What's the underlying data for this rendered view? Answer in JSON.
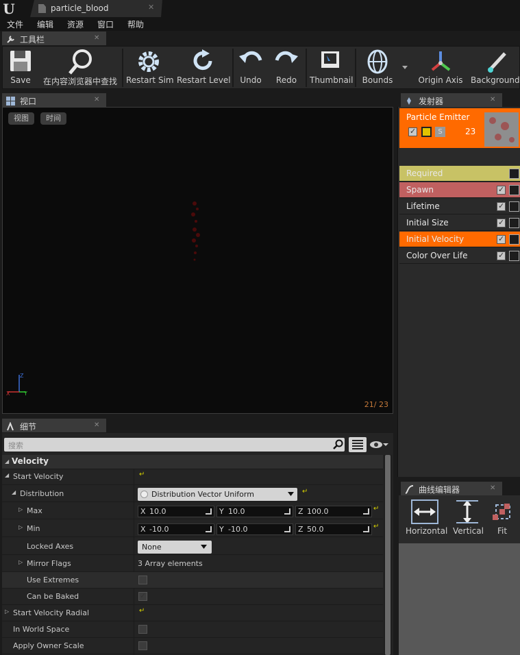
{
  "document_tab": {
    "title": "particle_blood"
  },
  "menu": [
    "文件",
    "编辑",
    "资源",
    "窗口",
    "帮助"
  ],
  "toolbar_panel": {
    "title": "工具栏"
  },
  "toolbar": [
    {
      "label": "Save",
      "icon": "save-icon"
    },
    {
      "label": "在内容浏览器中查找",
      "icon": "find-in-browser-icon"
    },
    {
      "label": "Restart Sim",
      "icon": "restart-sim-icon"
    },
    {
      "label": "Restart Level",
      "icon": "restart-level-icon"
    },
    {
      "label": "Undo",
      "icon": "undo-icon"
    },
    {
      "label": "Redo",
      "icon": "redo-icon"
    },
    {
      "label": "Thumbnail",
      "icon": "thumbnail-icon"
    },
    {
      "label": "Bounds",
      "icon": "bounds-icon"
    },
    {
      "label": "Origin Axis",
      "icon": "origin-axis-icon"
    },
    {
      "label": "Background C",
      "icon": "background-color-icon"
    }
  ],
  "viewport_panel": {
    "title": "视口",
    "view_button": "视图",
    "time_button": "时间",
    "frame_counter": "21/ 23"
  },
  "emitters_panel": {
    "title": "发射器",
    "emitter": {
      "name": "Particle Emitter",
      "count": "23",
      "solo_label": "S"
    },
    "modules": [
      {
        "name": "Required",
        "color": "#c8c265"
      },
      {
        "name": "Spawn",
        "color": "#c06060"
      },
      {
        "name": "Lifetime",
        "color": "#2a2a2a"
      },
      {
        "name": "Initial Size",
        "color": "#2a2a2a"
      },
      {
        "name": "Initial Velocity",
        "color": "#ff6a00"
      },
      {
        "name": "Color Over Life",
        "color": "#2a2a2a"
      }
    ]
  },
  "details_panel": {
    "title": "细节",
    "search_placeholder": "搜索",
    "category": "Velocity",
    "start_velocity": "Start Velocity",
    "distribution_label": "Distribution",
    "distribution_value": "Distribution Vector Uniform",
    "max": {
      "label": "Max",
      "x": "10.0",
      "y": "10.0",
      "z": "100.0"
    },
    "min": {
      "label": "Min",
      "x": "-10.0",
      "y": "-10.0",
      "z": "50.0"
    },
    "locked_axes": {
      "label": "Locked Axes",
      "value": "None"
    },
    "mirror_flags": {
      "label": "Mirror Flags",
      "value": "3 Array elements"
    },
    "use_extremes": {
      "label": "Use Extremes",
      "checked": false
    },
    "can_be_baked": {
      "label": "Can be Baked",
      "checked": true
    },
    "start_velocity_radial": "Start Velocity Radial",
    "in_world_space": {
      "label": "In World Space",
      "checked": false
    },
    "apply_owner_scale": {
      "label": "Apply Owner Scale",
      "checked": false
    }
  },
  "curve_editor": {
    "title": "曲线编辑器",
    "buttons": [
      {
        "label": "Horizontal"
      },
      {
        "label": "Vertical"
      },
      {
        "label": "Fit"
      }
    ]
  }
}
